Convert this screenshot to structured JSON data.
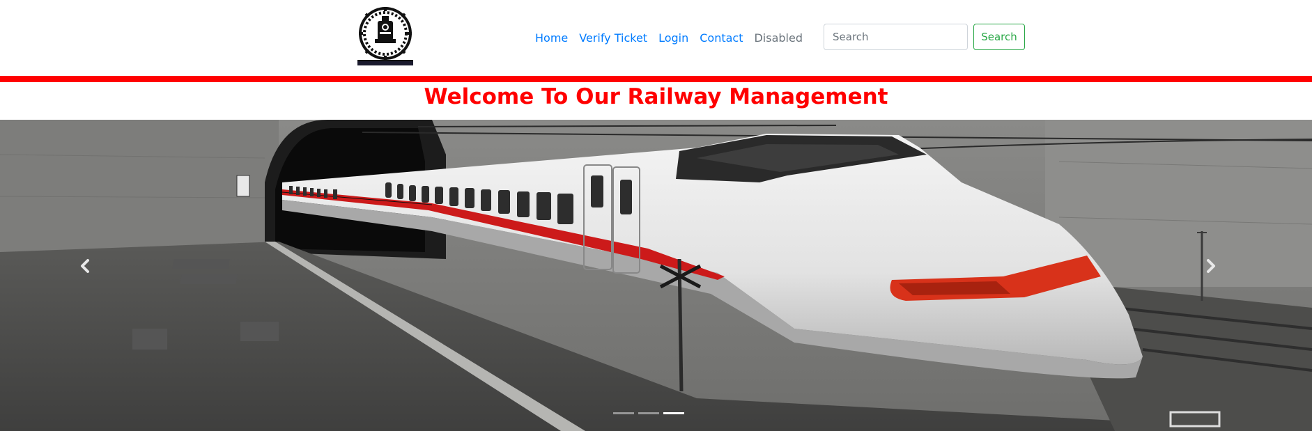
{
  "navbar": {
    "logo_icon": "steam-locomotive-emblem-icon",
    "links": [
      {
        "label": "Home"
      },
      {
        "label": "Verify Ticket"
      },
      {
        "label": "Login"
      },
      {
        "label": "Contact"
      },
      {
        "label": "Disabled"
      }
    ],
    "search": {
      "placeholder": "Search",
      "value": "",
      "button_label": "Search"
    }
  },
  "banner": {
    "title": "Welcome To Our Railway Management"
  },
  "carousel": {
    "slide_count": 3,
    "active_slide": 3,
    "prev_icon": "chevron-left-icon",
    "next_icon": "chevron-right-icon",
    "image": "bullet-train-tunnel-photo"
  },
  "colors": {
    "accent_red": "#ff0000",
    "link_blue": "#007bff",
    "disabled_gray": "#6c757d",
    "success_green": "#28a745"
  }
}
